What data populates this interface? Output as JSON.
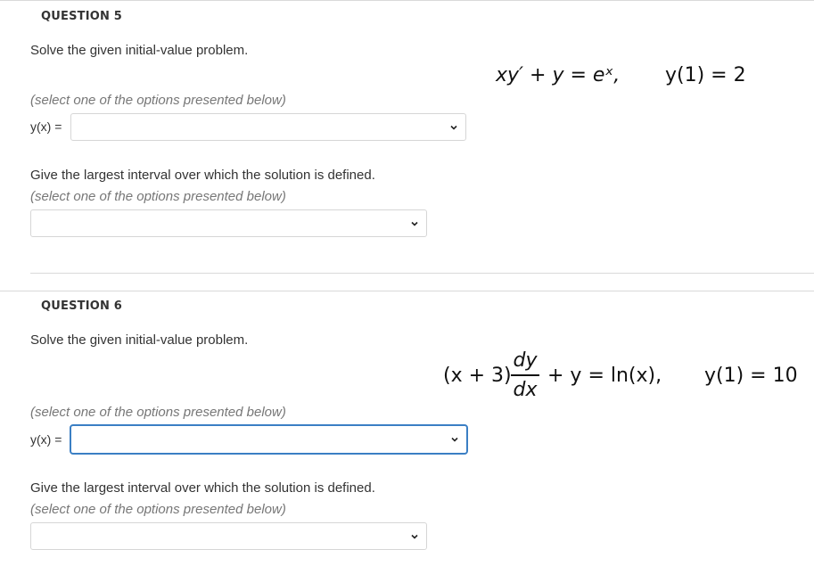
{
  "q5": {
    "title": "QUESTION 5",
    "prompt": "Solve the given initial-value problem.",
    "equation": "xy′ + y = eˣ,",
    "initial_condition": "y(1) = 2",
    "hint1": "(select one of the options presented below)",
    "yx_label": "y(x) =",
    "yx_value": "",
    "interval_prompt": "Give the largest interval over which the solution is defined.",
    "hint2": "(select one of the options presented below)",
    "interval_value": ""
  },
  "q6": {
    "title": "QUESTION 6",
    "prompt": "Solve the given initial-value problem.",
    "eq_left": "(x + 3)",
    "eq_num": "dy",
    "eq_den": "dx",
    "eq_right": "+ y = ln(x),",
    "initial_condition": "y(1) = 10",
    "hint1": "(select one of the options presented below)",
    "yx_label": "y(x) =",
    "yx_value": "",
    "interval_prompt": "Give the largest interval over which the solution is defined.",
    "hint2": "(select one of the options presented below)",
    "interval_value": ""
  },
  "icons": {
    "dropdown": "chevron-down-icon"
  }
}
